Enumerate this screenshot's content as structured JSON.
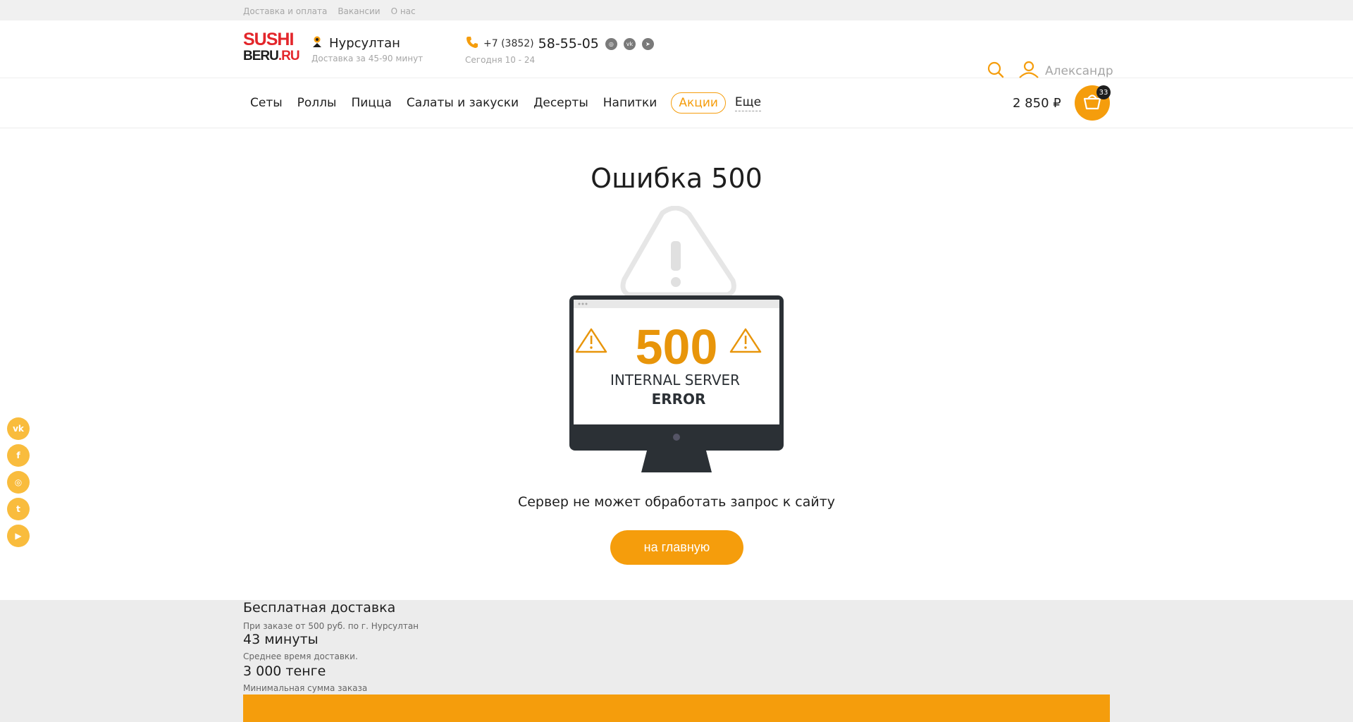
{
  "topbar": {
    "links": [
      "Доставка и оплата",
      "Вакансии",
      "О нас"
    ]
  },
  "logo": {
    "line1": "SUSHI",
    "line2a": "BERU",
    "line2b": ".RU"
  },
  "city": {
    "name": "Нурсултан",
    "delivery": "Доставка за 45-90 минут"
  },
  "phone": {
    "prefix": "+7 (3852)",
    "number": "58-55-05",
    "hours": "Сегодня 10 - 24",
    "socials": [
      "instagram-icon",
      "vk-icon",
      "telegram-icon"
    ]
  },
  "user": {
    "name": "Александр"
  },
  "nav": {
    "items": [
      "Сеты",
      "Роллы",
      "Пицца",
      "Салаты и закуски",
      "Десерты",
      "Напитки"
    ],
    "promo": "Акции",
    "more": "Еще"
  },
  "cart": {
    "sum": "2 850 ₽",
    "count": "33"
  },
  "error": {
    "title": "Ошибка 500",
    "code": "500",
    "line1": "INTERNAL SERVER",
    "line2": "ERROR",
    "description": "Сервер не может обработать запрос к сайту",
    "button": "на главную"
  },
  "side_social": [
    "vk-icon",
    "facebook-icon",
    "instagram-icon",
    "twitter-icon",
    "youtube-icon"
  ],
  "footer": {
    "blocks": [
      {
        "big": "Бесплатная доставка",
        "small": "При заказе от 500 руб. по г. Нурсултан"
      },
      {
        "big": "43 минуты",
        "small": "Среднее время доставки."
      },
      {
        "big": "3 000 тенге",
        "small": "Минимальная сумма заказа"
      }
    ]
  },
  "colors": {
    "accent": "#f59d0c",
    "brand_red": "#e3262b",
    "dark": "#2b3035"
  }
}
